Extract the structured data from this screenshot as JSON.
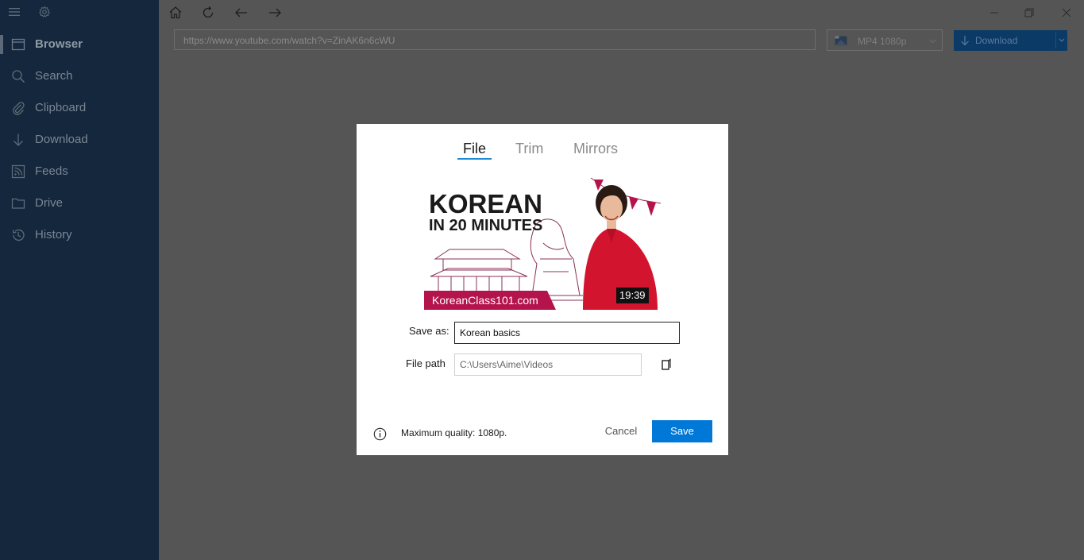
{
  "sidebar": {
    "items": [
      {
        "label": "Browser",
        "icon": "browser-icon",
        "active": true
      },
      {
        "label": "Search",
        "icon": "search-icon"
      },
      {
        "label": "Clipboard",
        "icon": "paperclip-icon"
      },
      {
        "label": "Download",
        "icon": "download-arrow-icon"
      },
      {
        "label": "Feeds",
        "icon": "rss-icon"
      },
      {
        "label": "Drive",
        "icon": "folder-icon"
      },
      {
        "label": "History",
        "icon": "history-icon"
      }
    ]
  },
  "toolbar": {
    "url": "https://www.youtube.com/watch?v=ZinAK6n6cWU",
    "format": "MP4 1080p",
    "download_label": "Download"
  },
  "dialog": {
    "tabs": [
      "File",
      "Trim",
      "Mirrors"
    ],
    "active_tab": "File",
    "thumbnail": {
      "title_line1": "KOREAN",
      "title_line2": "IN 20 MINUTES",
      "site": "KoreanClass101.com",
      "duration": "19:39"
    },
    "save_as_label": "Save as:",
    "save_as_value": "Korean basics",
    "file_path_label": "File path",
    "file_path_value": "C:\\Users\\Aime\\Videos",
    "info_text": "Maximum quality: 1080p.",
    "cancel_label": "Cancel",
    "save_label": "Save"
  },
  "colors": {
    "sidebar_bg": "#14273c",
    "overlay_bg": "#555555",
    "accent": "#0078d7",
    "brand_magenta": "#b5134b"
  }
}
